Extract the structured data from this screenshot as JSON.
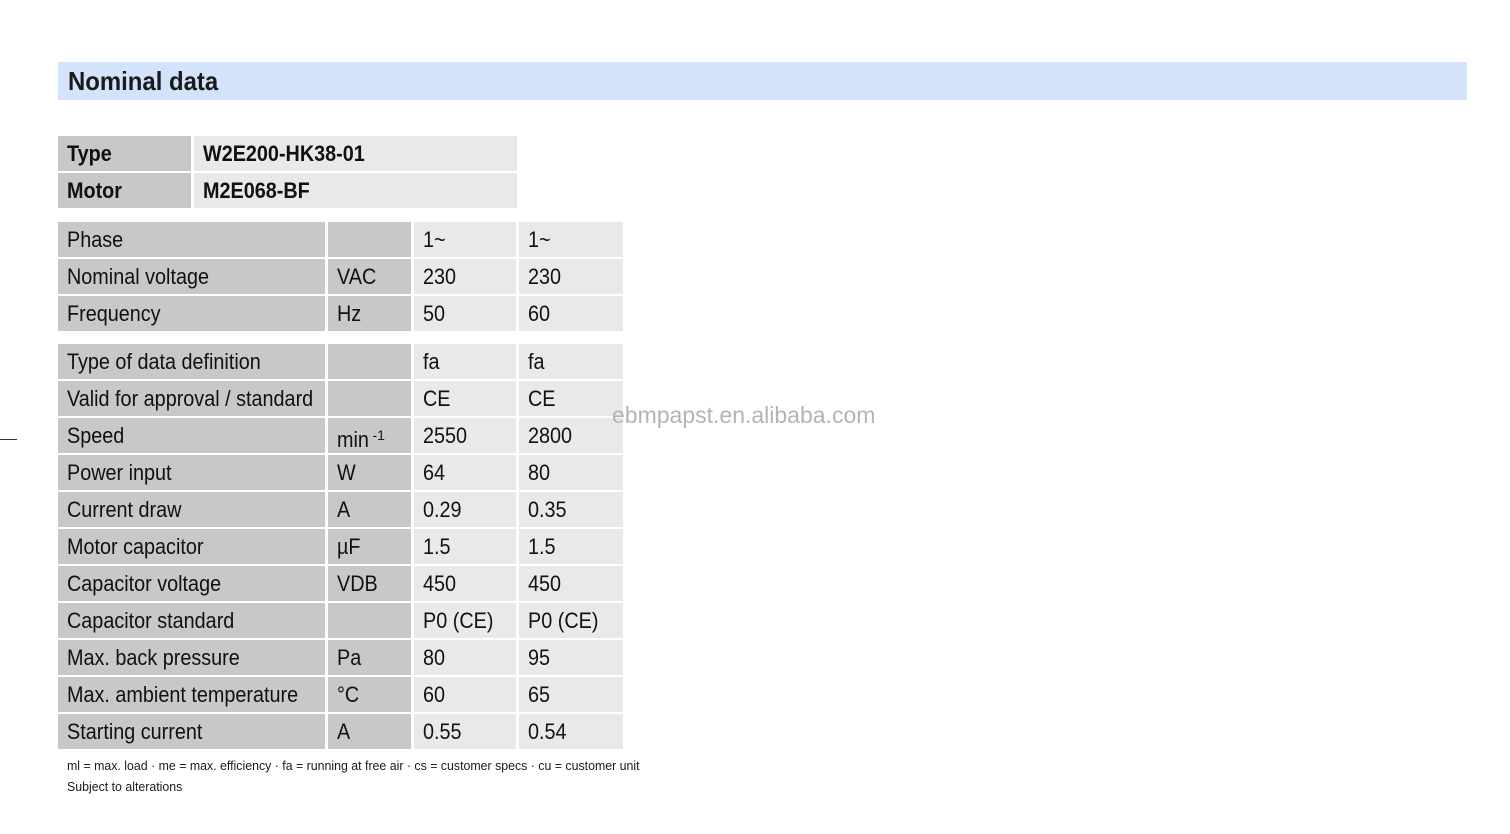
{
  "section": {
    "title": "Nominal data"
  },
  "identity": [
    {
      "label": "Type",
      "value": "W2E200-HK38-01"
    },
    {
      "label": "Motor",
      "value": "M2E068-BF"
    }
  ],
  "table1": [
    {
      "label": "Phase",
      "unit": "",
      "v1": "1~",
      "v2": "1~"
    },
    {
      "label": "Nominal voltage",
      "unit": "VAC",
      "v1": "230",
      "v2": "230"
    },
    {
      "label": "Frequency",
      "unit": "Hz",
      "v1": "50",
      "v2": "60"
    }
  ],
  "table2": [
    {
      "label": "Type of data definition",
      "unit": "",
      "v1": "fa",
      "v2": "fa"
    },
    {
      "label": "Valid for approval / standard",
      "unit": "",
      "v1": "CE",
      "v2": "CE"
    },
    {
      "label": "Speed",
      "unit": "min",
      "unit_sup": "-1",
      "v1": "2550",
      "v2": "2800"
    },
    {
      "label": "Power input",
      "unit": "W",
      "v1": "64",
      "v2": "80"
    },
    {
      "label": "Current draw",
      "unit": "A",
      "v1": "0.29",
      "v2": "0.35"
    },
    {
      "label": "Motor capacitor",
      "unit": "µF",
      "v1": "1.5",
      "v2": "1.5"
    },
    {
      "label": "Capacitor voltage",
      "unit": "VDB",
      "v1": "450",
      "v2": "450"
    },
    {
      "label": "Capacitor standard",
      "unit": "",
      "v1": "P0 (CE)",
      "v2": "P0 (CE)"
    },
    {
      "label": "Max. back pressure",
      "unit": "Pa",
      "v1": "80",
      "v2": "95"
    },
    {
      "label": "Max. ambient temperature",
      "unit": "°C",
      "v1": "60",
      "v2": "65"
    },
    {
      "label": "Starting current",
      "unit": "A",
      "v1": "0.55",
      "v2": "0.54"
    }
  ],
  "footnotes": {
    "legend": "ml = max. load · me = max. efficiency · fa = running at free air · cs = customer specs · cu = customer unit",
    "alterations": "Subject to alterations"
  },
  "watermark": "ebmpapst.en.alibaba.com"
}
